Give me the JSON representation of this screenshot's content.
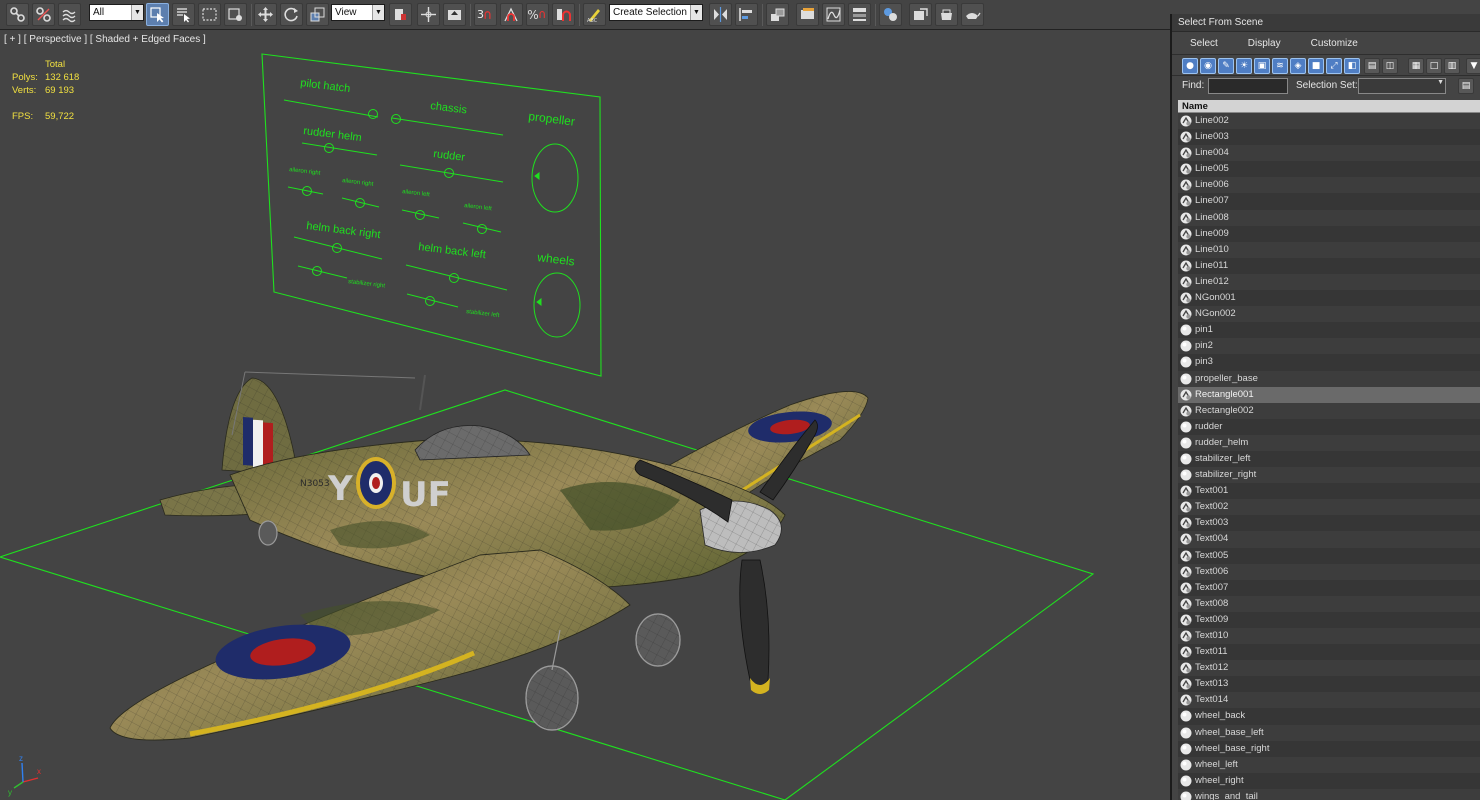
{
  "toolbar": {
    "filter_value": "All",
    "reference_coord": "View",
    "snap_3": "3",
    "snap_percent": "%",
    "named_selection_placeholder": "Create Selection Se"
  },
  "viewport": {
    "label": "[ + ] [ Perspective ] [ Shaded + Edged Faces ]",
    "stats": {
      "total_label": "Total",
      "polys_label": "Polys:",
      "polys_value": "132 618",
      "verts_label": "Verts:",
      "verts_value": "69 193",
      "fps_label": "FPS:",
      "fps_value": "59,722"
    },
    "control_panel": {
      "labels": [
        "pilot hatch",
        "chassis",
        "propeller",
        "rudder helm",
        "rudder",
        "aileron right",
        "aileron right",
        "aileron left",
        "aileron left",
        "helm back right",
        "helm back left",
        "wheels",
        "stabilizer right",
        "stabilizer left"
      ]
    },
    "plane_markings": {
      "left": "Y",
      "right": "UF",
      "serial": "N3053"
    },
    "axis": {
      "x": "x",
      "y": "y",
      "z": "z"
    }
  },
  "dialog": {
    "title": "Select From Scene",
    "menu": [
      "Select",
      "Display",
      "Customize"
    ],
    "find_label": "Find:",
    "find_value": "",
    "selection_set_label": "Selection Set:",
    "selection_set_value": "",
    "column_header": "Name",
    "selected_item": "Rectangle001",
    "items": [
      {
        "name": "Line002",
        "type": "shape"
      },
      {
        "name": "Line003",
        "type": "shape"
      },
      {
        "name": "Line004",
        "type": "shape"
      },
      {
        "name": "Line005",
        "type": "shape"
      },
      {
        "name": "Line006",
        "type": "shape"
      },
      {
        "name": "Line007",
        "type": "shape"
      },
      {
        "name": "Line008",
        "type": "shape"
      },
      {
        "name": "Line009",
        "type": "shape"
      },
      {
        "name": "Line010",
        "type": "shape"
      },
      {
        "name": "Line011",
        "type": "shape"
      },
      {
        "name": "Line012",
        "type": "shape"
      },
      {
        "name": "NGon001",
        "type": "shape"
      },
      {
        "name": "NGon002",
        "type": "shape"
      },
      {
        "name": "pin1",
        "type": "geometry"
      },
      {
        "name": "pin2",
        "type": "geometry"
      },
      {
        "name": "pin3",
        "type": "geometry"
      },
      {
        "name": "propeller_base",
        "type": "geometry"
      },
      {
        "name": "Rectangle001",
        "type": "shape"
      },
      {
        "name": "Rectangle002",
        "type": "shape"
      },
      {
        "name": "rudder",
        "type": "geometry"
      },
      {
        "name": "rudder_helm",
        "type": "geometry"
      },
      {
        "name": "stabilizer_left",
        "type": "geometry"
      },
      {
        "name": "stabilizer_right",
        "type": "geometry"
      },
      {
        "name": "Text001",
        "type": "shape"
      },
      {
        "name": "Text002",
        "type": "shape"
      },
      {
        "name": "Text003",
        "type": "shape"
      },
      {
        "name": "Text004",
        "type": "shape"
      },
      {
        "name": "Text005",
        "type": "shape"
      },
      {
        "name": "Text006",
        "type": "shape"
      },
      {
        "name": "Text007",
        "type": "shape"
      },
      {
        "name": "Text008",
        "type": "shape"
      },
      {
        "name": "Text009",
        "type": "shape"
      },
      {
        "name": "Text010",
        "type": "shape"
      },
      {
        "name": "Text011",
        "type": "shape"
      },
      {
        "name": "Text012",
        "type": "shape"
      },
      {
        "name": "Text013",
        "type": "shape"
      },
      {
        "name": "Text014",
        "type": "shape"
      },
      {
        "name": "wheel_back",
        "type": "geometry"
      },
      {
        "name": "wheel_base_left",
        "type": "geometry"
      },
      {
        "name": "wheel_base_right",
        "type": "geometry"
      },
      {
        "name": "wheel_left",
        "type": "geometry"
      },
      {
        "name": "wheel_right",
        "type": "geometry"
      },
      {
        "name": "wings_and_tail",
        "type": "geometry"
      }
    ]
  },
  "colors": {
    "viewport_bg": "#444444",
    "wire_green": "#1fe01f",
    "stats_yellow": "#f1e040",
    "selected_row": "#6a6a6a",
    "filter_active": "#4f7ec4"
  }
}
